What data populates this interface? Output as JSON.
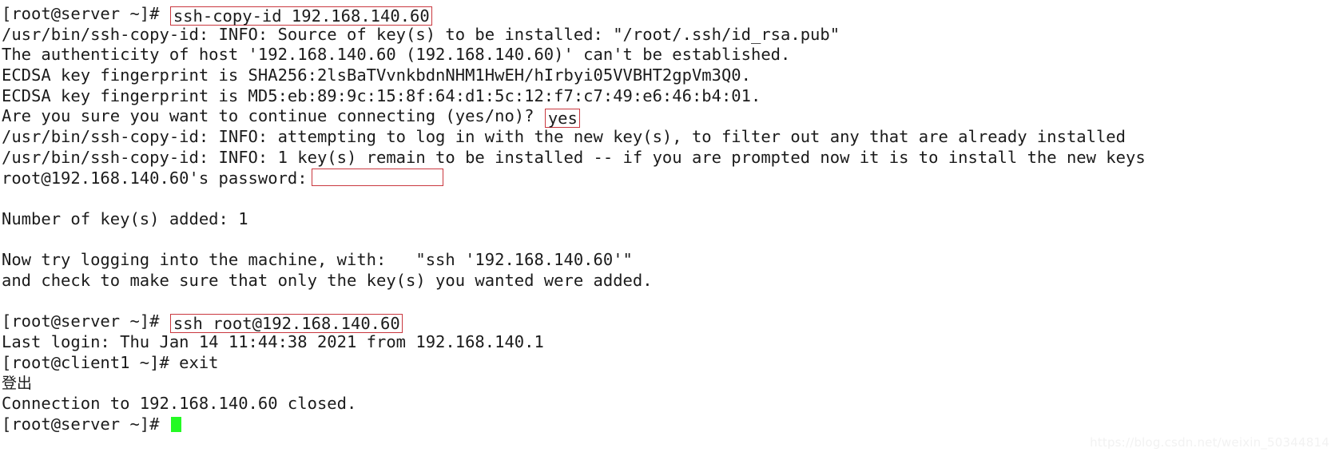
{
  "terminal": {
    "colors": {
      "background": "#ffffff",
      "foreground": "#1b1b1b",
      "highlight_box_border": "#c9383f",
      "cursor": "#24fa24",
      "watermark": "#f2f2f2"
    },
    "lines": [
      {
        "id": "line-prompt-sshcopyid",
        "prompt": "[root@server ~]# ",
        "command": "ssh-copy-id 192.168.140.60",
        "boxed": true
      },
      {
        "id": "line-info-source",
        "text": "/usr/bin/ssh-copy-id: INFO: Source of key(s) to be installed: \"/root/.ssh/id_rsa.pub\""
      },
      {
        "id": "line-authenticity",
        "text": "The authenticity of host '192.168.140.60 (192.168.140.60)' can't be established."
      },
      {
        "id": "line-fingerprint-sha256",
        "text": "ECDSA key fingerprint is SHA256:2lsBaTVvnkbdnNHM1HwEH/hIrbyi05VVBHT2gpVm3Q0."
      },
      {
        "id": "line-fingerprint-md5",
        "text": "ECDSA key fingerprint is MD5:eb:89:9c:15:8f:64:d1:5c:12:f7:c7:49:e6:46:b4:01."
      },
      {
        "id": "line-confirm-yes",
        "prompt": "Are you sure you want to continue connecting (yes/no)? ",
        "command": "yes",
        "boxed": true
      },
      {
        "id": "line-info-attempting",
        "text": "/usr/bin/ssh-copy-id: INFO: attempting to log in with the new key(s), to filter out any that are already installed"
      },
      {
        "id": "line-info-remain",
        "text": "/usr/bin/ssh-copy-id: INFO: 1 key(s) remain to be installed -- if you are prompted now it is to install the new keys"
      },
      {
        "id": "line-password-prompt",
        "prompt": "root@192.168.140.60's password:",
        "empty_box": true
      },
      {
        "id": "line-blank-1",
        "text": ""
      },
      {
        "id": "line-keys-added",
        "text": "Number of key(s) added: 1"
      },
      {
        "id": "line-blank-2",
        "text": ""
      },
      {
        "id": "line-now-try",
        "text": "Now try logging into the machine, with:   \"ssh '192.168.140.60'\""
      },
      {
        "id": "line-and-check",
        "text": "and check to make sure that only the key(s) you wanted were added."
      },
      {
        "id": "line-blank-3",
        "text": ""
      },
      {
        "id": "line-prompt-ssh",
        "prompt": "[root@server ~]# ",
        "command": "ssh root@192.168.140.60",
        "boxed": true
      },
      {
        "id": "line-last-login",
        "text": "Last login: Thu Jan 14 11:44:38 2021 from 192.168.140.1"
      },
      {
        "id": "line-prompt-exit",
        "text": "[root@client1 ~]# exit"
      },
      {
        "id": "line-logout-cjk",
        "text": "登出",
        "cjk": true
      },
      {
        "id": "line-connection-closed",
        "text": "Connection to 192.168.140.60 closed."
      },
      {
        "id": "line-prompt-final",
        "prompt": "[root@server ~]# ",
        "cursor": true
      }
    ],
    "watermark": "https://blog.csdn.net/weixin_50344814"
  }
}
